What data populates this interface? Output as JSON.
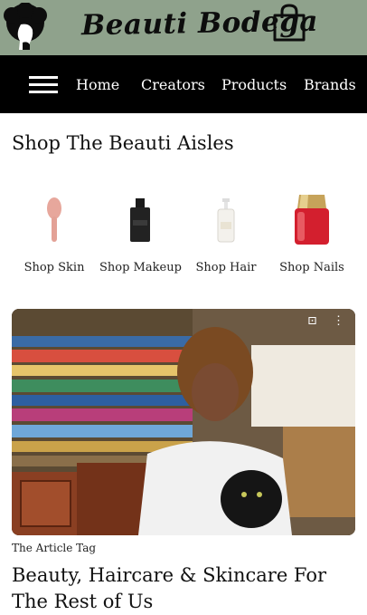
{
  "brand": {
    "title": "Beauti Bodega",
    "bg_color": "#8fa28c",
    "logo_icon": "afro-silhouette-logo",
    "cart_icon": "shopping-bag-icon"
  },
  "nav": {
    "menu_icon": "hamburger-menu-icon",
    "items": [
      {
        "label": "Home"
      },
      {
        "label": "Creators"
      },
      {
        "label": "Products"
      },
      {
        "label": "Brands"
      }
    ],
    "bg_color": "#000000"
  },
  "aisles": {
    "heading": "Shop The Beauti Aisles",
    "items": [
      {
        "label": "Shop Skin",
        "icon": "facial-brush-icon"
      },
      {
        "label": "Shop Makeup",
        "icon": "serum-bottle-icon"
      },
      {
        "label": "Shop Hair",
        "icon": "pump-bottle-icon"
      },
      {
        "label": "Shop Nails",
        "icon": "nail-polish-icon"
      }
    ]
  },
  "article": {
    "image_alt": "hero-photo",
    "scan_icon": "lens-scan-icon",
    "more_icon": "more-vertical-icon",
    "tag": "The Article Tag",
    "title": "Beauty, Haircare & Skincare For The Rest of Us"
  }
}
